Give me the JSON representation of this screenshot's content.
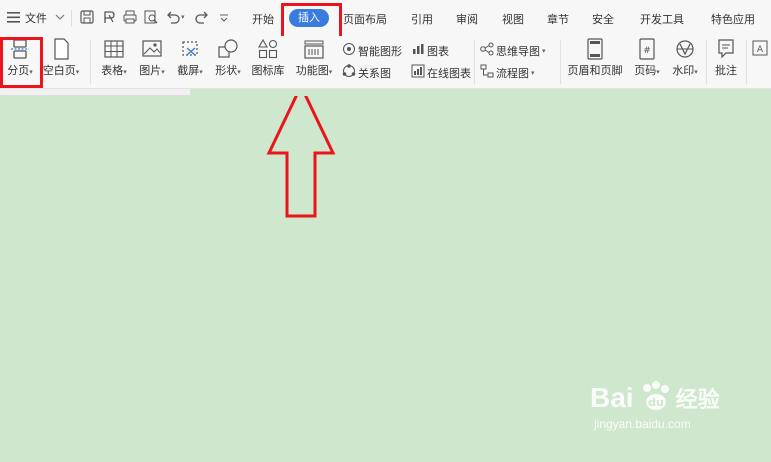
{
  "menu": {
    "file_label": "文件"
  },
  "tabs": [
    "开始",
    "插入",
    "页面布局",
    "引用",
    "审阅",
    "视图",
    "章节",
    "安全",
    "开发工具",
    "特色应用"
  ],
  "ribbon": {
    "page_break": "分页",
    "blank_page": "空白页",
    "table": "表格",
    "picture": "图片",
    "screenshot": "截屏",
    "shape": "形状",
    "icon_lib": "图标库",
    "func_chart": "功能图",
    "smart_art": "智能图形",
    "chart": "图表",
    "relation": "关系图",
    "online_chart": "在线图表",
    "mind_map": "思维导图",
    "flow_chart": "流程图",
    "header_footer": "页眉和页脚",
    "page_number": "页码",
    "watermark": "水印",
    "comment": "批注"
  },
  "watermark": {
    "brand": "Bai",
    "brand2": "经验",
    "url": "jingyan.baidu.com"
  },
  "colors": {
    "document_bg": "#cfe7cc",
    "accent": "#3a7be0",
    "highlight": "#e8151d"
  }
}
